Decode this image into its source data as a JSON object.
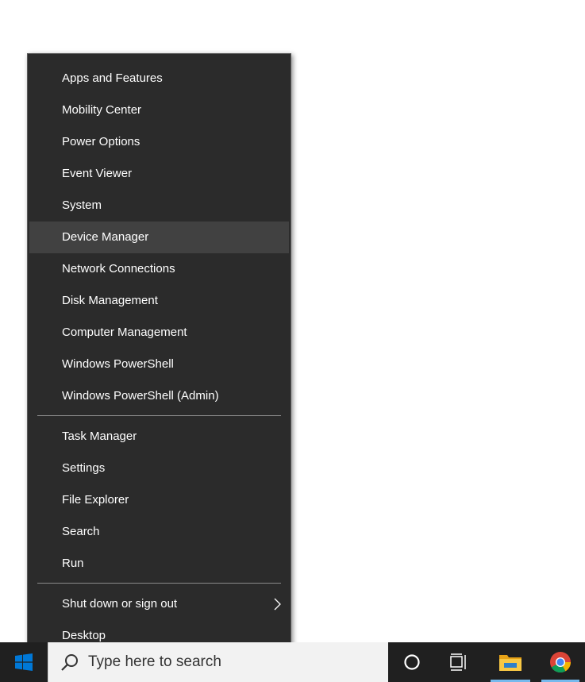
{
  "menu": {
    "group1": [
      {
        "label": "Apps and Features"
      },
      {
        "label": "Mobility Center"
      },
      {
        "label": "Power Options"
      },
      {
        "label": "Event Viewer"
      },
      {
        "label": "System"
      },
      {
        "label": "Device Manager",
        "highlighted": true
      },
      {
        "label": "Network Connections"
      },
      {
        "label": "Disk Management"
      },
      {
        "label": "Computer Management"
      },
      {
        "label": "Windows PowerShell"
      },
      {
        "label": "Windows PowerShell (Admin)"
      }
    ],
    "group2": [
      {
        "label": "Task Manager"
      },
      {
        "label": "Settings"
      },
      {
        "label": "File Explorer"
      },
      {
        "label": "Search"
      },
      {
        "label": "Run"
      }
    ],
    "group3": [
      {
        "label": "Shut down or sign out",
        "has_submenu": true
      },
      {
        "label": "Desktop"
      }
    ]
  },
  "taskbar": {
    "search_placeholder": "Type here to search",
    "icons": [
      "windows-logo-icon",
      "search-icon",
      "cortana-icon",
      "task-view-icon",
      "file-explorer-icon",
      "chrome-icon"
    ]
  },
  "colors": {
    "menu_bg": "#2b2b2b",
    "menu_hover": "#414141",
    "taskbar_bg": "#202020",
    "accent": "#0078d7",
    "active_indicator": "#76b9ed"
  }
}
